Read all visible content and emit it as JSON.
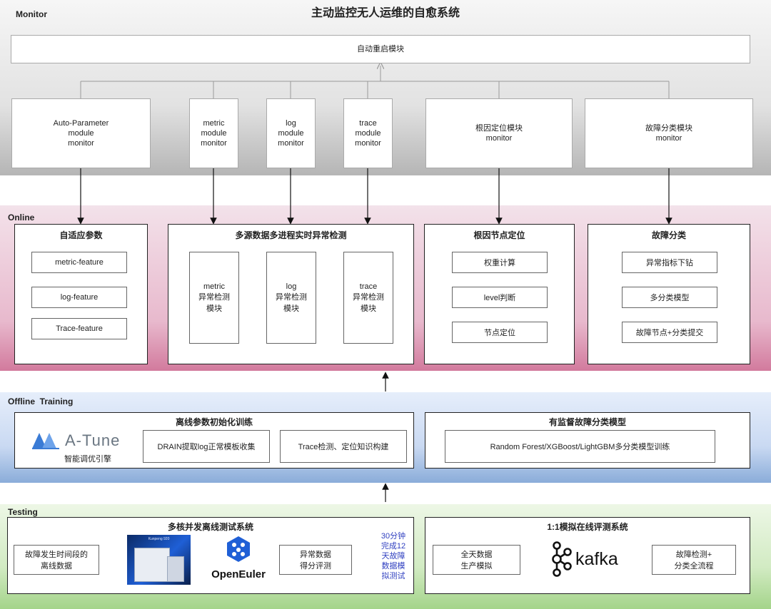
{
  "bands": {
    "monitor": "Monitor",
    "online": "Online",
    "offline": "Offline  Training",
    "testing": "Testing"
  },
  "main_title": "主动监控无人运维的自愈系统",
  "restart_module": "自动重启模块",
  "monitors": [
    "Auto-Parameter\nmodule\nmonitor",
    "metric\nmodule\nmonitor",
    "log\nmodule\nmonitor",
    "trace\nmodule\nmonitor",
    "根因定位模块\nmonitor",
    "故障分类模块\nmonitor"
  ],
  "online": {
    "adaptive": {
      "title": "自适应参数",
      "items": [
        "metric-feature",
        "log-feature",
        "Trace-feature"
      ]
    },
    "multisource": {
      "title": "多源数据多进程实时异常检测",
      "items": [
        "metric\n异常检测\n模块",
        "log\n异常检测\n模块",
        "trace\n异常检测\n模块"
      ]
    },
    "rootcause": {
      "title": "根因节点定位",
      "items": [
        "权重计算",
        "level判断",
        "节点定位"
      ]
    },
    "faultclass": {
      "title": "故障分类",
      "items": [
        "异常指标下钻",
        "多分类模型",
        "故障节点+分类提交"
      ]
    }
  },
  "offline": {
    "left_title": "离线参数初始化训练",
    "atune_logo": "A-Tune",
    "atune_caption": "智能调优引擎",
    "drain": "DRAIN提取log正常模板收集",
    "trace": "Trace检测、定位知识构建",
    "right_title": "有监督故障分类模型",
    "rf": "Random Forest/XGBoost/LightGBM多分类模型训练"
  },
  "testing": {
    "left_title": "多核并发离线测试系统",
    "fault_data": "故障发生时间段的\n离线数据",
    "server_label": "Kunpeng 920",
    "openeuler": "OpenEuler",
    "score": "异常数据\n得分评测",
    "note": "30分钟\n完成12\n天故障\n数据模\n拟测试",
    "right_title": "1:1模拟在线评测系统",
    "fullday": "全天数据\n生产模拟",
    "kafka": "kafka",
    "result": "故障检测+\n分类全流程"
  },
  "colors": {
    "monitor_band_top": "#f4f4f4",
    "monitor_band_bottom": "#b0b0b0",
    "online_band_top": "#f2dde8",
    "online_band_bottom": "#d27a9d",
    "offline_band_top": "#e3ecfa",
    "offline_band_bottom": "#8aacd9",
    "testing_band_top": "#e9f5e1",
    "testing_band_bottom": "#a4d48a",
    "atune_blue": "#3a7bd5",
    "note_blue": "#3040c0",
    "openeuler_blue": "#1f5fd6"
  }
}
